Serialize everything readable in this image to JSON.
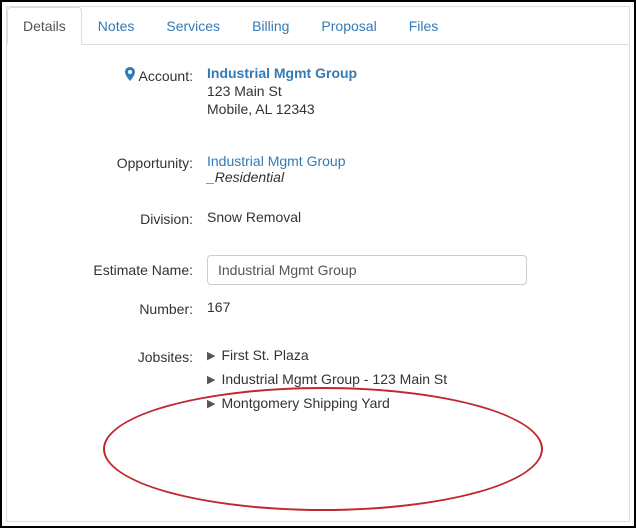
{
  "tabs": {
    "details": "Details",
    "notes": "Notes",
    "services": "Services",
    "billing": "Billing",
    "proposal": "Proposal",
    "files": "Files"
  },
  "labels": {
    "account": "Account:",
    "opportunity": "Opportunity:",
    "division": "Division:",
    "estimate_name": "Estimate Name:",
    "number": "Number:",
    "jobsites": "Jobsites:"
  },
  "account": {
    "name": "Industrial Mgmt Group",
    "street": "123 Main St",
    "city_line": "Mobile, AL  12343"
  },
  "opportunity": {
    "name": "Industrial Mgmt Group",
    "type": "_Residential"
  },
  "division": "Snow Removal",
  "estimate_name": "Industrial Mgmt Group",
  "number": "167",
  "jobsites": [
    "First St. Plaza",
    "Industrial Mgmt Group - 123 Main St",
    "Montgomery Shipping Yard"
  ]
}
